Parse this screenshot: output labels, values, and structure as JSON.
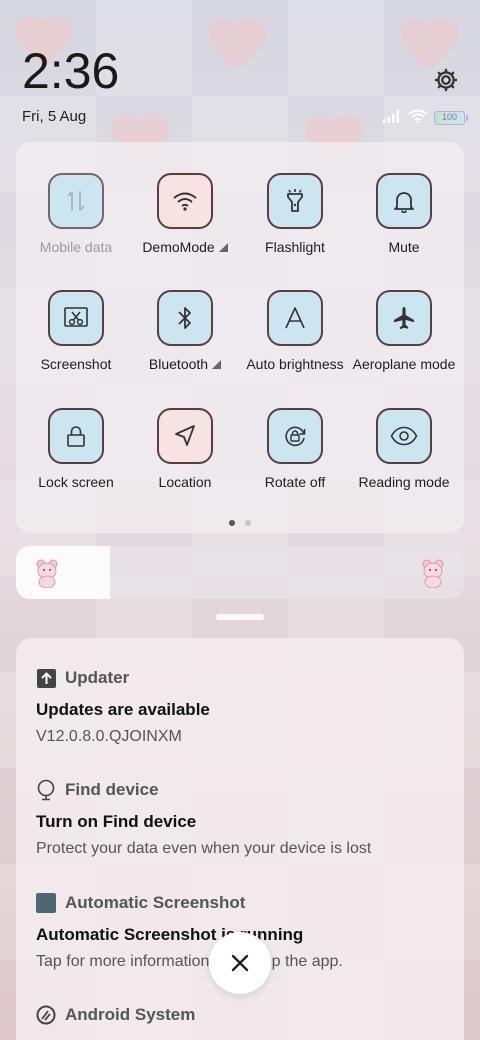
{
  "status": {
    "time": "2:36",
    "date": "Fri, 5 Aug",
    "battery_level": "100"
  },
  "quick_settings": {
    "tiles": [
      {
        "label": "Mobile data",
        "icon": "mobile-data-icon",
        "state": "disabled"
      },
      {
        "label": "DemoMode",
        "icon": "wifi-icon",
        "state": "on",
        "has_menu": true
      },
      {
        "label": "Flashlight",
        "icon": "flashlight-icon",
        "state": "off"
      },
      {
        "label": "Mute",
        "icon": "bell-icon",
        "state": "off"
      },
      {
        "label": "Screenshot",
        "icon": "screenshot-icon",
        "state": "off"
      },
      {
        "label": "Bluetooth",
        "icon": "bluetooth-icon",
        "state": "off",
        "has_menu": true
      },
      {
        "label": "Auto brightness",
        "icon": "auto-brightness-icon",
        "state": "off"
      },
      {
        "label": "Aeroplane mode",
        "icon": "airplane-icon",
        "state": "off"
      },
      {
        "label": "Lock screen",
        "icon": "lock-icon",
        "state": "off"
      },
      {
        "label": "Location",
        "icon": "location-icon",
        "state": "on"
      },
      {
        "label": "Rotate off",
        "icon": "rotate-lock-icon",
        "state": "off"
      },
      {
        "label": "Reading mode",
        "icon": "eye-icon",
        "state": "off"
      }
    ],
    "page_count": 2,
    "current_page": 1
  },
  "brightness": {
    "level": 0.21
  },
  "notifications": [
    {
      "app": "Updater",
      "icon": "updater-icon",
      "title": "Updates are available",
      "text": "V12.0.8.0.QJOINXM"
    },
    {
      "app": "Find device",
      "icon": "find-device-icon",
      "title": "Turn on Find device",
      "text": "Protect your data even when your device is lost"
    },
    {
      "app": "Automatic Screenshot",
      "icon": "automatic-screenshot-icon",
      "title": "Automatic Screenshot is running",
      "text": "Tap for more information or to stop the app."
    },
    {
      "app": "Android System",
      "icon": "android-system-icon",
      "title": "",
      "text": ""
    }
  ],
  "colors": {
    "tile_blue": "#cce6f1",
    "tile_pink": "#f7e2e4",
    "tile_border": "#5a3e42",
    "battery_accent": "#c2a7e3"
  }
}
